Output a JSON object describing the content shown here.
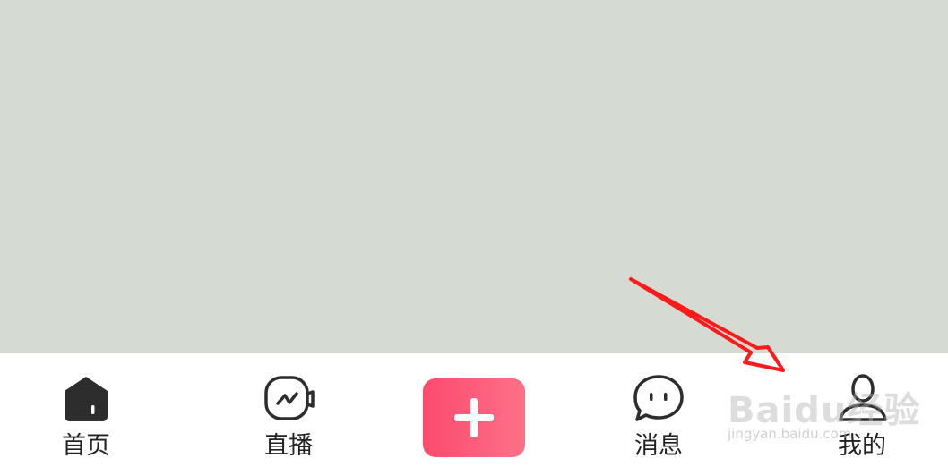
{
  "content": {
    "background": "#d5dad3"
  },
  "tab_bar": {
    "items": [
      {
        "label": "首页",
        "icon": "home-icon"
      },
      {
        "label": "直播",
        "icon": "live-icon"
      },
      {
        "label": "",
        "icon": "plus-icon"
      },
      {
        "label": "消息",
        "icon": "chat-bubble-icon"
      },
      {
        "label": "我的",
        "icon": "person-icon"
      }
    ],
    "create_button_colors": [
      "#fc4b6d",
      "#fd7088"
    ]
  },
  "annotation": {
    "arrow_color": "#ff0000"
  },
  "watermark": {
    "logo": "Baidu经验",
    "url": "jingyan.baidu.com"
  }
}
